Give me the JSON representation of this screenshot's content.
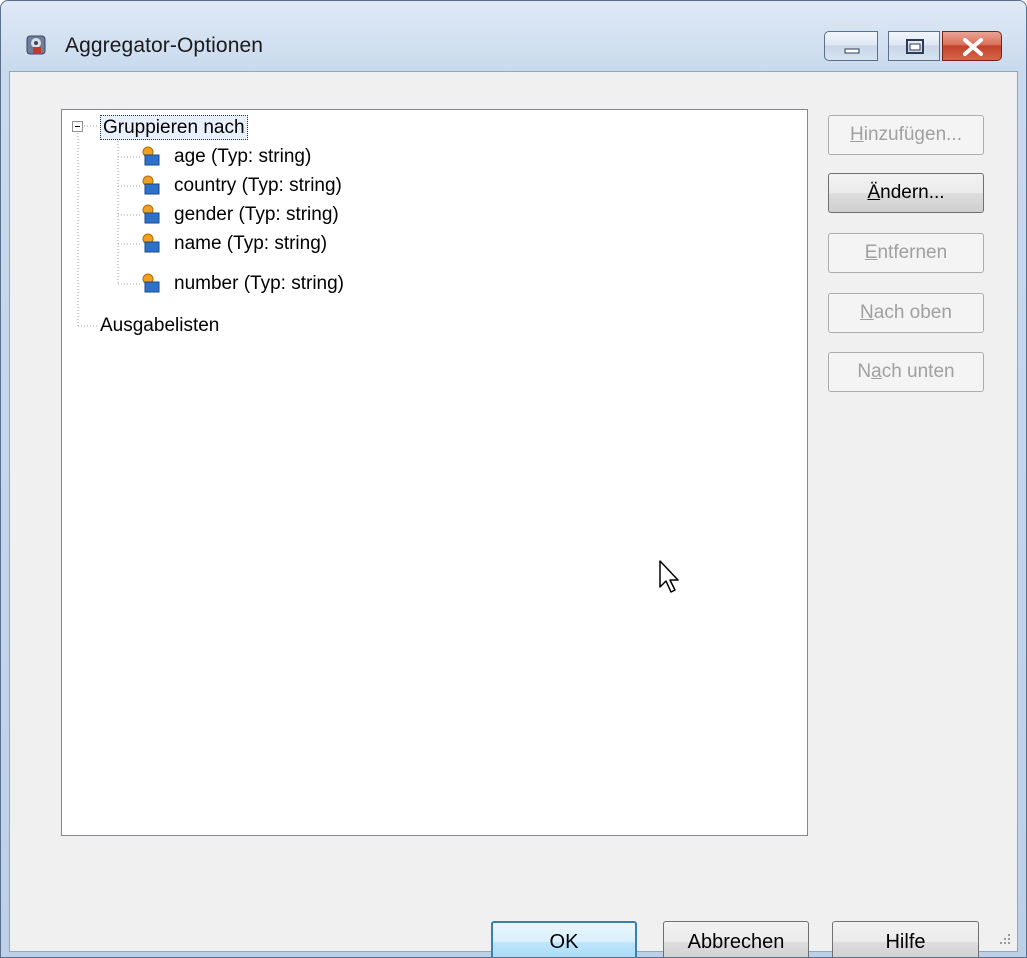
{
  "window": {
    "title": "Aggregator-Optionen"
  },
  "tree": {
    "root_label": "Gruppieren nach",
    "children": [
      "age (Typ: string)",
      "country (Typ: string)",
      "gender (Typ: string)",
      "name (Typ: string)",
      "number (Typ: string)"
    ],
    "output_label": "Ausgabelisten"
  },
  "side_buttons": {
    "add": {
      "label_pre": "",
      "label_key": "H",
      "label_post": "inzufügen...",
      "enabled": false
    },
    "edit": {
      "label_pre": "",
      "label_key": "Ä",
      "label_post": "ndern...",
      "enabled": true
    },
    "remove": {
      "label_pre": "",
      "label_key": "E",
      "label_post": "ntfernen",
      "enabled": false
    },
    "up": {
      "label_pre": "",
      "label_key": "N",
      "label_post": "ach oben",
      "enabled": false
    },
    "down": {
      "label_pre": "N",
      "label_key": "a",
      "label_post": "ch unten",
      "enabled": false
    }
  },
  "bottom_buttons": {
    "ok": "OK",
    "cancel": "Abbrechen",
    "help": "Hilfe"
  },
  "icons": {
    "app": "aggregator-app-icon",
    "field": "field-key-icon",
    "cursor": "mouse-pointer-icon"
  }
}
